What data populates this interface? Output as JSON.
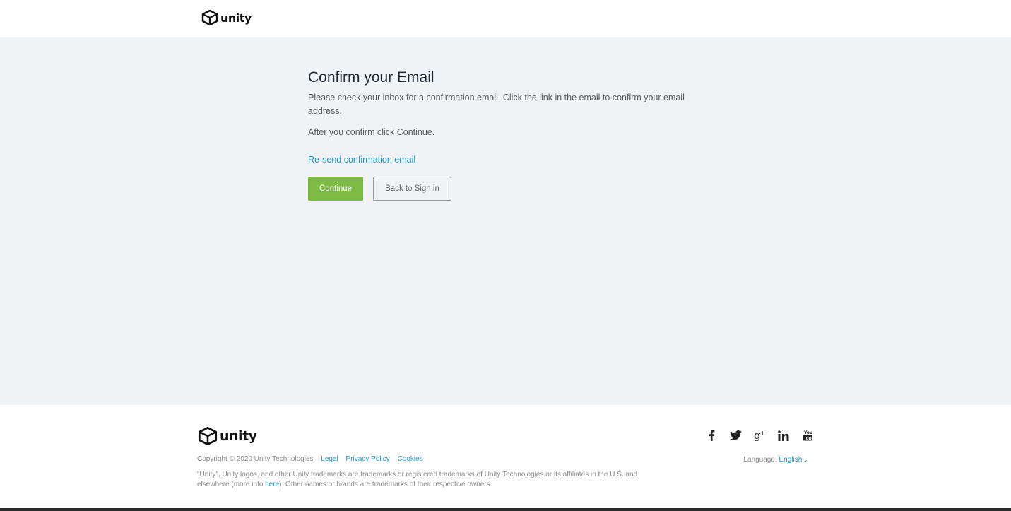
{
  "header": {
    "logo_text": "unity"
  },
  "main": {
    "title": "Confirm your Email",
    "description": "Please check your inbox for a confirmation email. Click the link in the email to confirm your email address.",
    "after_text": "After you confirm click Continue.",
    "resend_link": "Re-send confirmation email",
    "continue_label": "Continue",
    "back_label": "Back to Sign in"
  },
  "footer": {
    "logo_text": "unity",
    "copyright": "Copyright © 2020 Unity Technologies",
    "links": {
      "legal": "Legal",
      "privacy": "Privacy Policy",
      "cookies": "Cookies"
    },
    "trademark_before": "\"Unity\", Unity logos, and other Unity trademarks are trademarks or registered trademarks of Unity Technologies or its affiliates in the U.S. and elsewhere (more info ",
    "trademark_link": "here",
    "trademark_after": "). Other names or brands are trademarks of their respective owners.",
    "language_label": "Language:",
    "language_value": "English",
    "social_icons": [
      "facebook-icon",
      "twitter-icon",
      "google-plus-icon",
      "linkedin-icon",
      "youtube-icon"
    ]
  },
  "colors": {
    "accent_green": "#7dbb42",
    "link_blue": "#2196c7",
    "page_bg": "#f0f3f5"
  }
}
